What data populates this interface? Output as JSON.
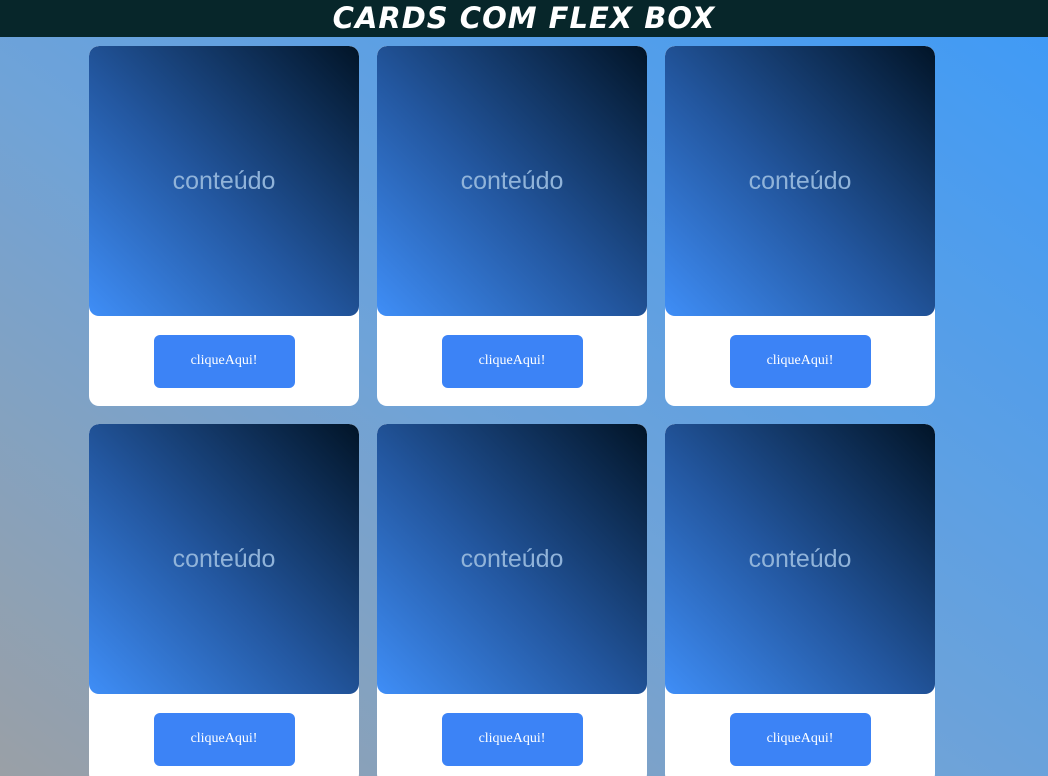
{
  "header": {
    "title": "CARDS COM FLEX BOX"
  },
  "cards": [
    {
      "content": "conteúdo",
      "button_label": "cliqueAqui!"
    },
    {
      "content": "conteúdo",
      "button_label": "cliqueAqui!"
    },
    {
      "content": "conteúdo",
      "button_label": "cliqueAqui!"
    },
    {
      "content": "conteúdo",
      "button_label": "cliqueAqui!"
    },
    {
      "content": "conteúdo",
      "button_label": "cliqueAqui!"
    },
    {
      "content": "conteúdo",
      "button_label": "cliqueAqui!"
    }
  ],
  "colors": {
    "header_bg": "#07262a",
    "button_bg": "#3c83f6",
    "card_bg": "#ffffff"
  }
}
